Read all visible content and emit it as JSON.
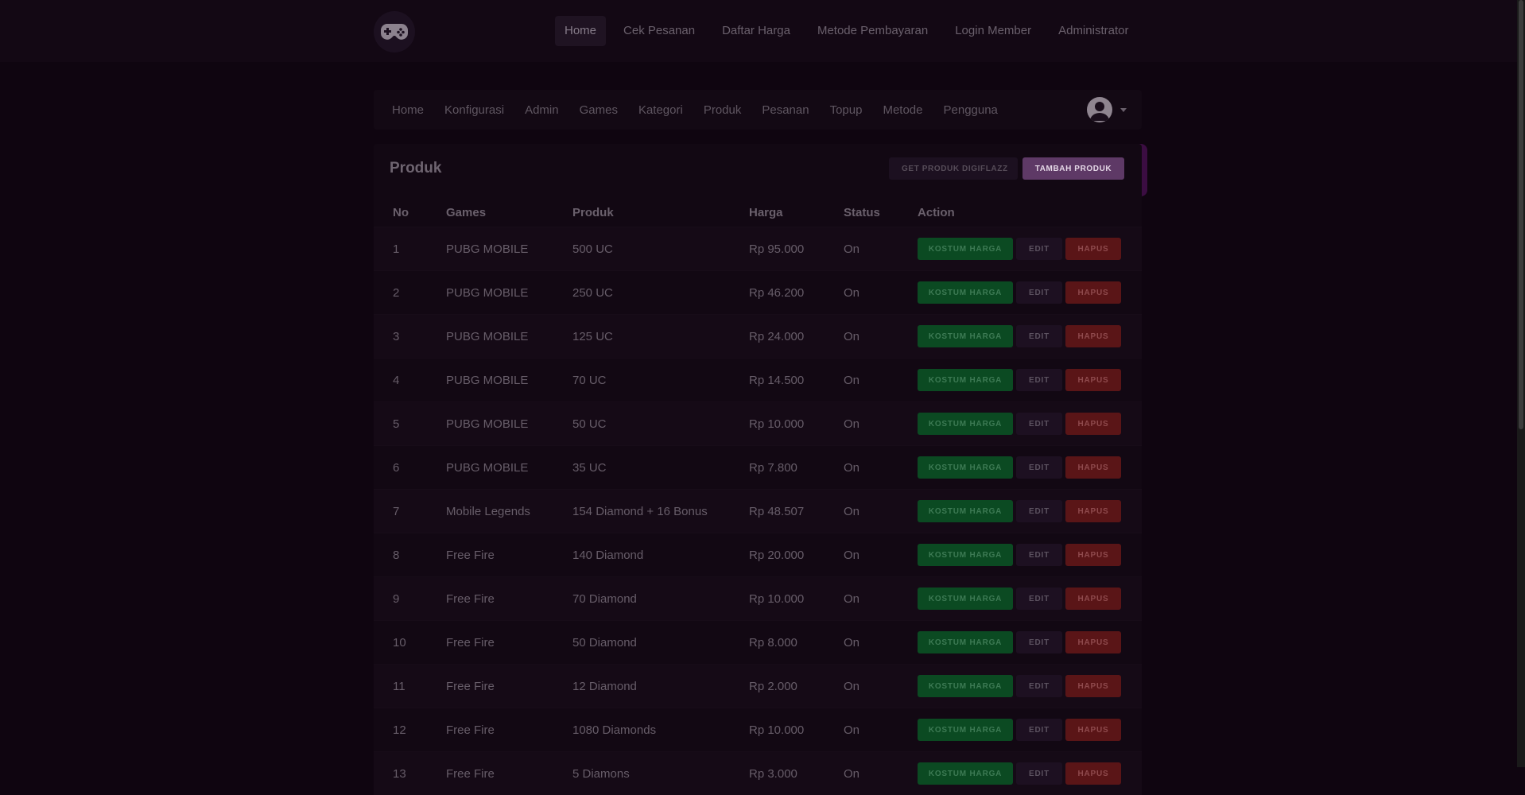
{
  "topnav": {
    "logo_icon": "gamepad-icon",
    "items": [
      {
        "label": "Home",
        "active": true
      },
      {
        "label": "Cek Pesanan"
      },
      {
        "label": "Daftar Harga"
      },
      {
        "label": "Metode Pembayaran"
      },
      {
        "label": "Login Member"
      },
      {
        "label": "Administrator"
      }
    ]
  },
  "subnav": {
    "links": [
      "Home",
      "Konfigurasi",
      "Admin",
      "Games",
      "Kategori",
      "Produk",
      "Pesanan",
      "Topup",
      "Metode",
      "Pengguna"
    ],
    "avatar_icon": "user-avatar-icon"
  },
  "card": {
    "title": "Produk",
    "btn_digiflazz": "GET PRODUK DIGIFLAZZ",
    "btn_tambah": "TAMBAH PRODUK"
  },
  "table": {
    "headers": [
      "No",
      "Games",
      "Produk",
      "Harga",
      "Status",
      "Action"
    ],
    "action_labels": {
      "kostum": "KOSTUM HARGA",
      "edit": "EDIT",
      "hapus": "HAPUS"
    },
    "rows": [
      {
        "no": "1",
        "game": "PUBG MOBILE",
        "produk": "500 UC",
        "harga": "Rp 95.000",
        "status": "On"
      },
      {
        "no": "2",
        "game": "PUBG MOBILE",
        "produk": "250 UC",
        "harga": "Rp 46.200",
        "status": "On"
      },
      {
        "no": "3",
        "game": "PUBG MOBILE",
        "produk": "125 UC",
        "harga": "Rp 24.000",
        "status": "On"
      },
      {
        "no": "4",
        "game": "PUBG MOBILE",
        "produk": "70 UC",
        "harga": "Rp 14.500",
        "status": "On"
      },
      {
        "no": "5",
        "game": "PUBG MOBILE",
        "produk": "50 UC",
        "harga": "Rp 10.000",
        "status": "On"
      },
      {
        "no": "6",
        "game": "PUBG MOBILE",
        "produk": "35 UC",
        "harga": "Rp 7.800",
        "status": "On"
      },
      {
        "no": "7",
        "game": "Mobile Legends",
        "produk": "154 Diamond + 16 Bonus",
        "harga": "Rp 48.507",
        "status": "On"
      },
      {
        "no": "8",
        "game": "Free Fire",
        "produk": "140 Diamond",
        "harga": "Rp 20.000",
        "status": "On"
      },
      {
        "no": "9",
        "game": "Free Fire",
        "produk": "70 Diamond",
        "harga": "Rp 10.000",
        "status": "On"
      },
      {
        "no": "10",
        "game": "Free Fire",
        "produk": "50 Diamond",
        "harga": "Rp 8.000",
        "status": "On"
      },
      {
        "no": "11",
        "game": "Free Fire",
        "produk": "12 Diamond",
        "harga": "Rp 2.000",
        "status": "On"
      },
      {
        "no": "12",
        "game": "Free Fire",
        "produk": "1080 Diamonds",
        "harga": "Rp 10.000",
        "status": "On"
      },
      {
        "no": "13",
        "game": "Free Fire",
        "produk": "5 Diamons",
        "harga": "Rp 3.000",
        "status": "On"
      }
    ]
  }
}
